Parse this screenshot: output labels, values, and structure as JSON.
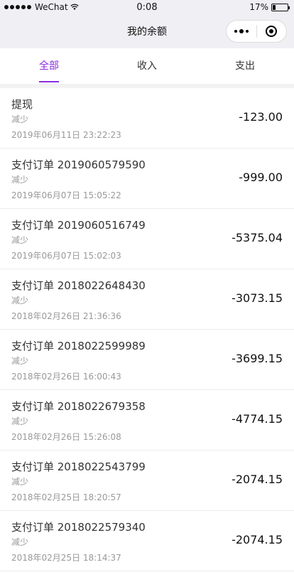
{
  "status_bar": {
    "carrier": "WeChat",
    "time": "0:08",
    "battery": "17%"
  },
  "nav": {
    "title": "我的余额"
  },
  "tabs": [
    {
      "label": "全部",
      "active": true
    },
    {
      "label": "收入",
      "active": false
    },
    {
      "label": "支出",
      "active": false
    }
  ],
  "records": [
    {
      "title": "提现",
      "type": "减少",
      "time": "2019年06月11日 23:22:23",
      "amount": "-123.00"
    },
    {
      "title": "支付订单 2019060579590",
      "type": "减少",
      "time": "2019年06月07日 15:05:22",
      "amount": "-999.00"
    },
    {
      "title": "支付订单 2019060516749",
      "type": "减少",
      "time": "2019年06月07日 15:02:03",
      "amount": "-5375.04"
    },
    {
      "title": "支付订单 2018022648430",
      "type": "减少",
      "time": "2018年02月26日 21:36:36",
      "amount": "-3073.15"
    },
    {
      "title": "支付订单 2018022599989",
      "type": "减少",
      "time": "2018年02月26日 16:00:43",
      "amount": "-3699.15"
    },
    {
      "title": "支付订单 2018022679358",
      "type": "减少",
      "time": "2018年02月26日 15:26:08",
      "amount": "-4774.15"
    },
    {
      "title": "支付订单 2018022543799",
      "type": "减少",
      "time": "2018年02月25日 18:20:57",
      "amount": "-2074.15"
    },
    {
      "title": "支付订单 2018022579340",
      "type": "减少",
      "time": "2018年02月25日 18:14:37",
      "amount": "-2074.15"
    }
  ]
}
